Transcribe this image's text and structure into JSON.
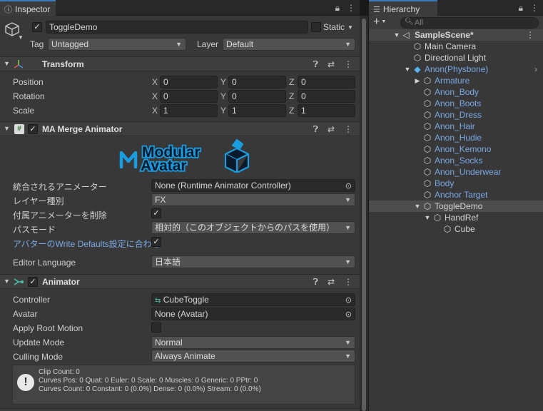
{
  "inspector": {
    "tab_label": "Inspector",
    "object_name": "ToggleDemo",
    "static_label": "Static",
    "tag_label": "Tag",
    "tag_value": "Untagged",
    "layer_label": "Layer",
    "layer_value": "Default",
    "transform": {
      "title": "Transform",
      "position_label": "Position",
      "rotation_label": "Rotation",
      "scale_label": "Scale",
      "x": "X",
      "y": "Y",
      "z": "Z",
      "position": [
        "0",
        "0",
        "0"
      ],
      "rotation": [
        "0",
        "0",
        "0"
      ],
      "scale": [
        "1",
        "1",
        "1"
      ]
    },
    "merge_animator": {
      "title": "MA Merge Animator",
      "logo_line1": "Modular",
      "logo_line2": "Avatar",
      "animator_label": "統合されるアニメーター",
      "animator_value": "None (Runtime Animator Controller)",
      "layer_type_label": "レイヤー種別",
      "layer_type_value": "FX",
      "delete_attached_label": "付属アニメーターを削除",
      "path_mode_label": "パスモード",
      "path_mode_value": "相対的（このオブジェクトからのパスを使用）",
      "write_defaults_label": "アバターのWrite Defaults設定に合わせ",
      "editor_language_label": "Editor Language",
      "editor_language_value": "日本語"
    },
    "animator": {
      "title": "Animator",
      "controller_label": "Controller",
      "controller_value": "CubeToggle",
      "avatar_label": "Avatar",
      "avatar_value": "None (Avatar)",
      "apply_root_motion_label": "Apply Root Motion",
      "update_mode_label": "Update Mode",
      "update_mode_value": "Normal",
      "culling_mode_label": "Culling Mode",
      "culling_mode_value": "Always Animate",
      "info_line1": "Clip Count: 0",
      "info_line2": "Curves Pos: 0 Quat: 0 Euler: 0 Scale: 0 Muscles: 0 Generic: 0 PPtr: 0",
      "info_line3": "Curves Count: 0 Constant: 0 (0.0%) Dense: 0 (0.0%) Stream: 0 (0.0%)"
    }
  },
  "hierarchy": {
    "tab_label": "Hierarchy",
    "add_label": "+",
    "search_placeholder": "All",
    "items": [
      {
        "label": "SampleScene*",
        "color": "#d4d4d4"
      },
      {
        "label": "Main Camera",
        "color": "#d4d4d4"
      },
      {
        "label": "Directional Light",
        "color": "#d4d4d4"
      },
      {
        "label": "Anon(Physbone)",
        "color": "#7aa9e6"
      },
      {
        "label": "Armature",
        "color": "#7aa9e6"
      },
      {
        "label": "Anon_Body",
        "color": "#7aa9e6"
      },
      {
        "label": "Anon_Boots",
        "color": "#7aa9e6"
      },
      {
        "label": "Anon_Dress",
        "color": "#7aa9e6"
      },
      {
        "label": "Anon_Hair",
        "color": "#7aa9e6"
      },
      {
        "label": "Anon_Hudie",
        "color": "#7aa9e6"
      },
      {
        "label": "Anon_Kemono",
        "color": "#7aa9e6"
      },
      {
        "label": "Anon_Socks",
        "color": "#7aa9e6"
      },
      {
        "label": "Anon_Underwear",
        "color": "#7aa9e6"
      },
      {
        "label": "Body",
        "color": "#7aa9e6"
      },
      {
        "label": "Anchor Target",
        "color": "#7aa9e6"
      },
      {
        "label": "ToggleDemo",
        "color": "#d4d4d4"
      },
      {
        "label": "HandRef",
        "color": "#d4d4d4"
      },
      {
        "label": "Cube",
        "color": "#d4d4d4"
      }
    ]
  }
}
